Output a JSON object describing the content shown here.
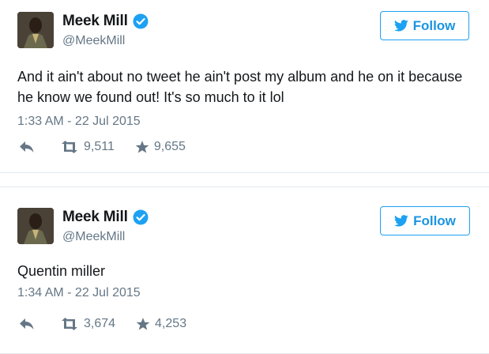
{
  "accent_color": "#1da1f2",
  "tweets": [
    {
      "display_name": "Meek Mill",
      "handle": "@MeekMill",
      "follow_label": "Follow",
      "text": "And it ain't about no tweet he ain't post my album and he on it because he know we found out!  It's so much to it lol",
      "timestamp": "1:33 AM - 22 Jul 2015",
      "retweets": "9,511",
      "likes": "9,655",
      "icons": [
        "avatar",
        "verified-badge-icon",
        "twitter-bird-icon",
        "reply-icon",
        "retweet-icon",
        "star-icon"
      ]
    },
    {
      "display_name": "Meek Mill",
      "handle": "@MeekMill",
      "follow_label": "Follow",
      "text": "Quentin miller",
      "timestamp": "1:34 AM - 22 Jul 2015",
      "retweets": "3,674",
      "likes": "4,253",
      "icons": [
        "avatar",
        "verified-badge-icon",
        "twitter-bird-icon",
        "reply-icon",
        "retweet-icon",
        "star-icon"
      ]
    }
  ]
}
